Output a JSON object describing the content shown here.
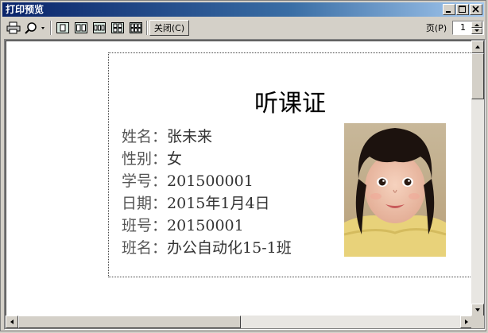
{
  "window": {
    "title": "打印预览"
  },
  "toolbar": {
    "close_label": "关闭(C)",
    "page_label": "页(P)",
    "page_value": "1"
  },
  "card": {
    "title": "听课证",
    "fields": [
      {
        "label": "姓名：",
        "value": "张未来"
      },
      {
        "label": "性别：",
        "value": "女"
      },
      {
        "label": "学号：",
        "value": "201500001"
      },
      {
        "label": "日期：",
        "value": "2015年1月4日"
      },
      {
        "label": "班号：",
        "value": "20150001"
      },
      {
        "label": "班名：",
        "value": "办公自动化15-1班"
      }
    ]
  },
  "colors": {
    "title_bar": "#0a246a",
    "window_bg": "#d4d0c8"
  }
}
